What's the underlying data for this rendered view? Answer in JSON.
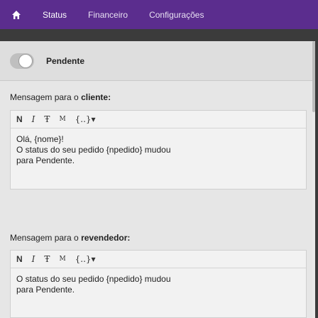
{
  "nav": {
    "home_icon": "home-icon",
    "tabs": [
      {
        "label": "Status"
      },
      {
        "label": "Financeiro"
      },
      {
        "label": "Configurações"
      }
    ]
  },
  "status": {
    "label": "Pendente",
    "toggle_on": false
  },
  "client_message": {
    "label_prefix": "Mensagem para o ",
    "label_bold": "cliente:",
    "toolbar": [
      "N",
      "I",
      "Ŧ",
      "M",
      "{..}▾"
    ],
    "lines": [
      "Olá, {nome}!",
      "O status do seu pedido {npedido} mudou",
      "para Pendente."
    ]
  },
  "reseller_message": {
    "label_prefix": "Mensagem para o ",
    "label_bold": "revendedor:",
    "toolbar": [
      "N",
      "I",
      "Ŧ",
      "M",
      "{..}▾"
    ],
    "lines": [
      "O status do seu pedido {npedido} mudou",
      "para Pendente."
    ]
  },
  "colors": {
    "nav_bg": "#5b2d8e",
    "panel_bg": "#e6e6e6"
  }
}
